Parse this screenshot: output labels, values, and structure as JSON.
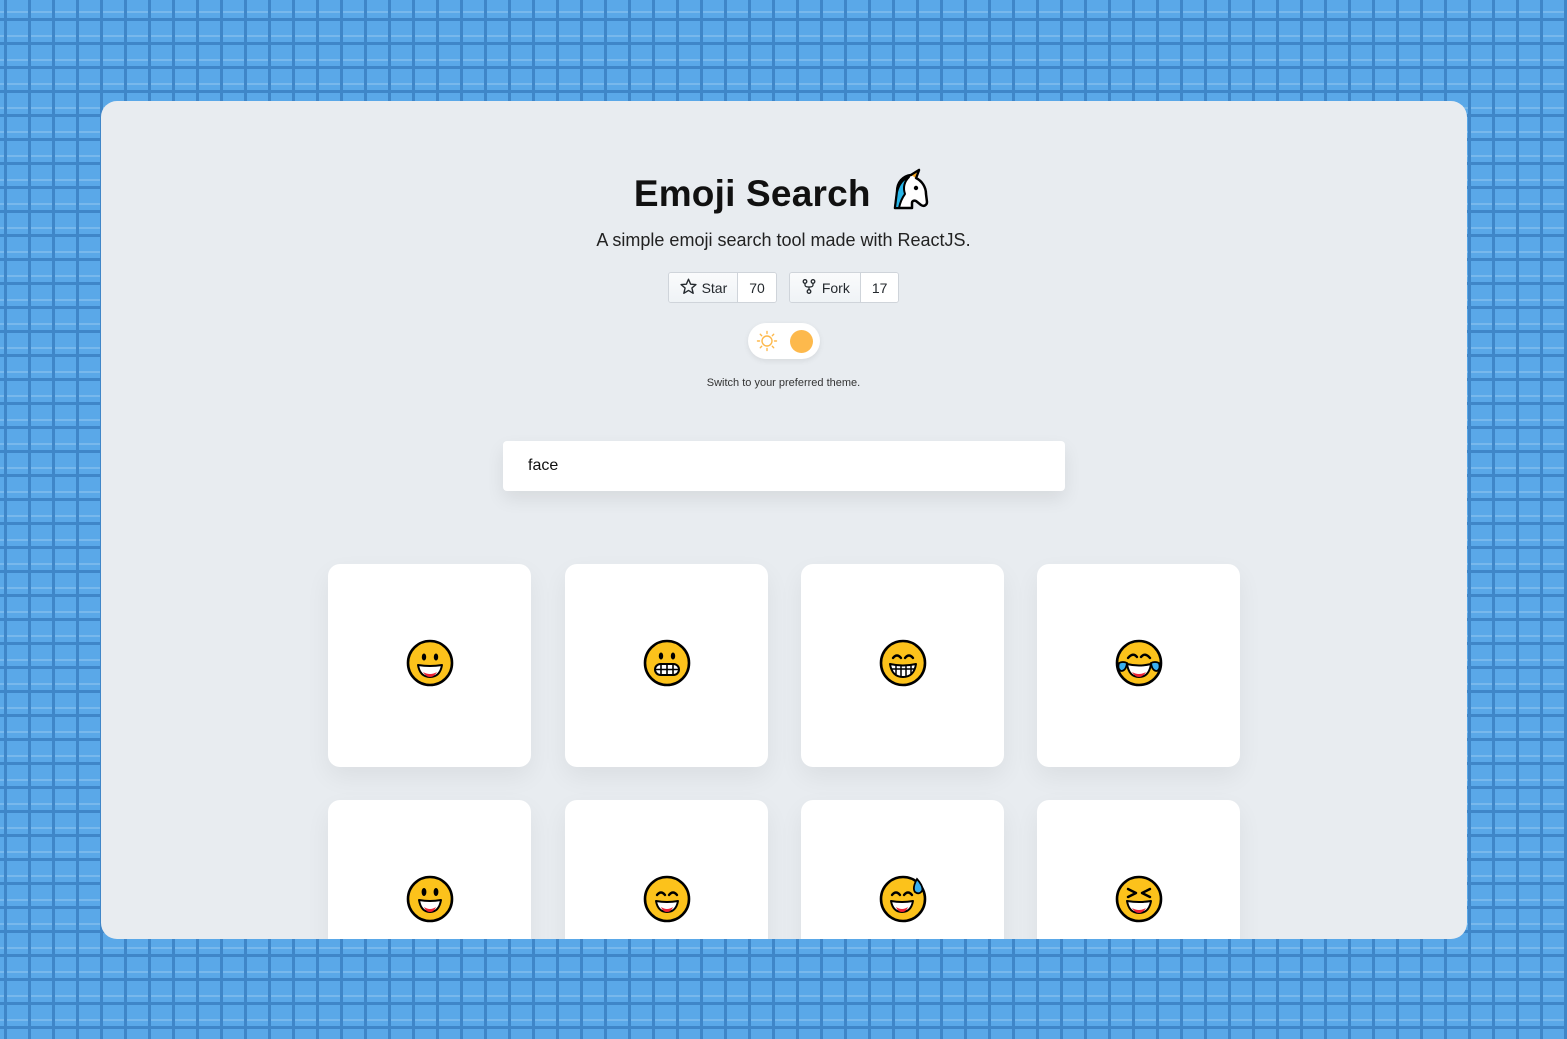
{
  "app": {
    "title": "Emoji Search",
    "subtitle": "A simple emoji search tool made with ReactJS."
  },
  "github": {
    "star_label": "Star",
    "star_count": "70",
    "fork_label": "Fork",
    "fork_count": "17"
  },
  "theme": {
    "caption": "Switch to your preferred theme.",
    "mode": "light",
    "accent": "#fdb94c"
  },
  "search": {
    "value": "face"
  },
  "results": [
    {
      "icon": "grinning-face-icon"
    },
    {
      "icon": "grimacing-face-icon"
    },
    {
      "icon": "beaming-face-icon"
    },
    {
      "icon": "tears-of-joy-face-icon"
    },
    {
      "icon": "smiley-face-icon"
    },
    {
      "icon": "smiling-eyes-face-icon"
    },
    {
      "icon": "sweat-smile-face-icon"
    },
    {
      "icon": "squinting-face-icon"
    }
  ],
  "colors": {
    "background": "#5aa8e8",
    "panel": "#e8ecf0",
    "emoji_yellow": "#fcc21b"
  }
}
